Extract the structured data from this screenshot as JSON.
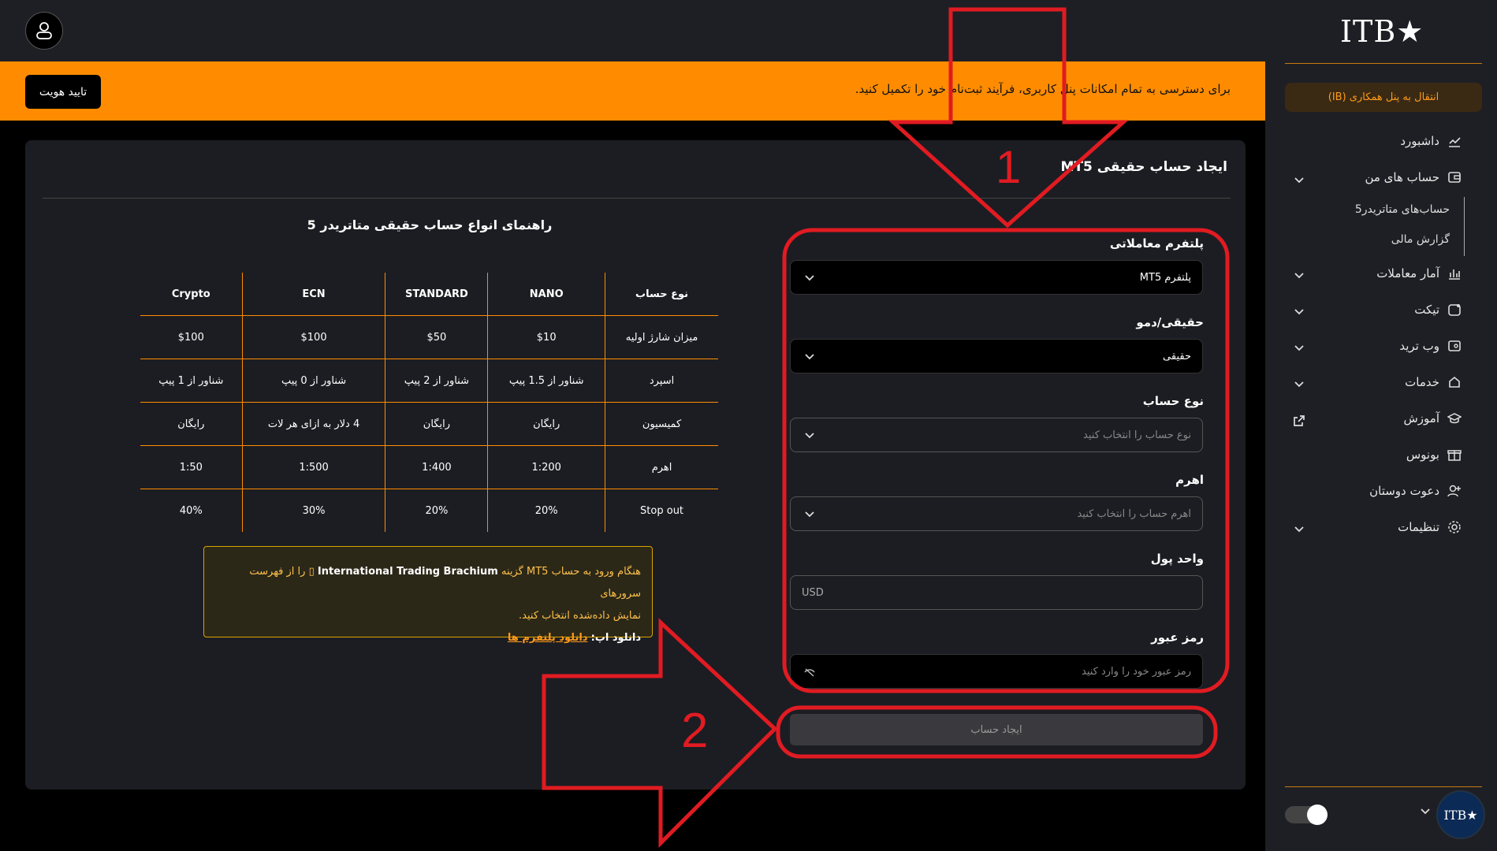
{
  "topbar": {
    "user_icon": "user-icon"
  },
  "banner": {
    "text": "برای دسترسی به تمام امکانات پنل کاربری، فرآیند ثبت‌نام خود را تکمیل کنید.",
    "verify_button": "تایید هویت",
    "color": "#ff8c00"
  },
  "sidebar": {
    "logo": "ITB★",
    "ib_button": "انتقال به پنل همکاری (IB)",
    "items": [
      {
        "label": "داشبورد",
        "icon": "chart-icon"
      },
      {
        "label": "حساب های من",
        "icon": "wallet-icon"
      },
      {
        "label": "آمار معاملات",
        "icon": "bar-chart-icon"
      },
      {
        "label": "تیکت",
        "icon": "ticket-icon"
      },
      {
        "label": "وب ترید",
        "icon": "web-trade-icon"
      },
      {
        "label": "خدمات",
        "icon": "services-icon"
      },
      {
        "label": "آموزش",
        "icon": "graduation-icon"
      },
      {
        "label": "بونوس",
        "icon": "gift-icon"
      },
      {
        "label": "دعوت دوستان",
        "icon": "add-user-icon"
      },
      {
        "label": "تنظیمات",
        "icon": "gear-icon"
      }
    ],
    "sub_items": [
      "حساب‌های متاتریدر5",
      "گزارش مالی"
    ],
    "avatar_text": "ITB★"
  },
  "form": {
    "title": "ایجاد حساب حقیقی MT5",
    "platform_label": "پلتفرم معاملاتی",
    "platform_value": "پلتفرم MT5",
    "type_label": "حقیقی/دمو",
    "type_value": "حقیقی",
    "account_label": "نوع حساب",
    "account_placeholder": "نوع حساب را انتخاب کنید",
    "leverage_label": "اهرم",
    "leverage_placeholder": "اهرم حساب را انتخاب کنید",
    "currency_label": "واحد پول",
    "currency_value": "USD",
    "password_label": "رمز عبور",
    "password_placeholder": "رمز عبور خود را وارد کنید",
    "submit": "ایجاد حساب"
  },
  "guide": {
    "title": "راهنمای انواع حساب حقیقی متاتریدر 5",
    "headers": [
      "نوع حساب",
      "NANO",
      "STANDARD",
      "ECN",
      "Crypto"
    ],
    "rows": [
      [
        "میزان شارژ اولیه",
        "$10",
        "$50",
        "$100",
        "$100"
      ],
      [
        "اسپرد",
        "شناور از 1.5 پیپ",
        "شناور از 2 پیپ",
        "شناور از 0 پیپ",
        "شناور از 1 پیپ"
      ],
      [
        "کمیسیون",
        "رایگان",
        "رایگان",
        "4 دلار به ازای هر لات",
        "رایگان"
      ],
      [
        "اهرم",
        "1:200",
        "1:400",
        "1:500",
        "1:50"
      ],
      [
        "Stop out",
        "20%",
        "20%",
        "30%",
        "40%"
      ]
    ]
  },
  "note": {
    "line1_a": "هنگام ورود به حساب MT5 گزینه",
    "server": "International Trading Brachium",
    "line1_b": "را از فهرست سرورهای",
    "line2": "نمایش داده‌شده انتخاب کنید.",
    "download_label": "دانلود اپ:",
    "download_link": "دانلود پلتفرم ها"
  },
  "annotations": {
    "label_1": "1",
    "label_2": "2",
    "color": "#e11b22"
  }
}
